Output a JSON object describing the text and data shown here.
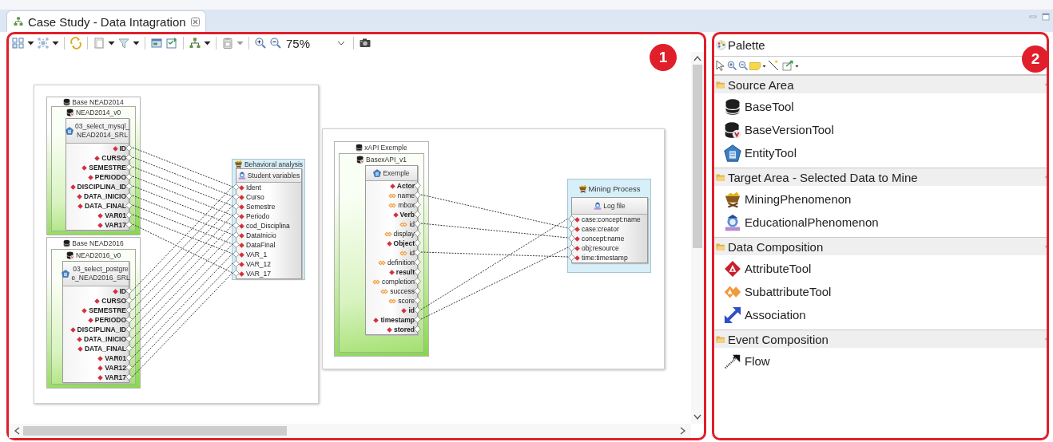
{
  "tab": {
    "title": "Case Study - Data Intagration",
    "selected": true
  },
  "editor": {
    "zoom": "75%",
    "callout": "1",
    "frames": [
      {
        "nodes": [
          {
            "kind": "source",
            "title": "Base NEAD2014",
            "version": "NEAD2014_v0",
            "entity": "03_select_mysql_\nNEAD2014_SRL",
            "attributes": [
              {
                "label": "ID",
                "kind": "attribute"
              },
              {
                "label": "CURSO",
                "kind": "attribute"
              },
              {
                "label": "SEMESTRE",
                "kind": "attribute"
              },
              {
                "label": "PERIODO",
                "kind": "attribute"
              },
              {
                "label": "DISCIPLINA_ID",
                "kind": "attribute"
              },
              {
                "label": "DATA_INICIO",
                "kind": "attribute"
              },
              {
                "label": "DATA_FINAL",
                "kind": "attribute"
              },
              {
                "label": "VAR01",
                "kind": "attribute"
              },
              {
                "label": "VAR17",
                "kind": "attribute"
              }
            ]
          },
          {
            "kind": "source",
            "title": "Base NEAD2016",
            "version": "NEAD2016_v0",
            "entity": "03_select_postgre\ne_NEAD2016_SRL",
            "attributes": [
              {
                "label": "ID",
                "kind": "attribute"
              },
              {
                "label": "CURSO",
                "kind": "attribute"
              },
              {
                "label": "SEMESTRE",
                "kind": "attribute"
              },
              {
                "label": "PERIODO",
                "kind": "attribute"
              },
              {
                "label": "DISCIPLINA_ID",
                "kind": "attribute"
              },
              {
                "label": "DATA_INICIO",
                "kind": "attribute"
              },
              {
                "label": "DATA_FINAL",
                "kind": "attribute"
              },
              {
                "label": "VAR01",
                "kind": "attribute"
              },
              {
                "label": "VAR12",
                "kind": "attribute"
              },
              {
                "label": "VAR17",
                "kind": "attribute"
              }
            ]
          },
          {
            "kind": "target",
            "title": "Behavioral analysis",
            "entity": "Student variables",
            "attributes": [
              {
                "label": "Ident",
                "kind": "attribute"
              },
              {
                "label": "Curso",
                "kind": "attribute"
              },
              {
                "label": "Semestre",
                "kind": "attribute"
              },
              {
                "label": "Periodo",
                "kind": "attribute"
              },
              {
                "label": "cod_Disciplina",
                "kind": "attribute"
              },
              {
                "label": "DataInicio",
                "kind": "attribute"
              },
              {
                "label": "DataFinal",
                "kind": "attribute"
              },
              {
                "label": "VAR_1",
                "kind": "attribute"
              },
              {
                "label": "VAR_12",
                "kind": "attribute"
              },
              {
                "label": "VAR_17",
                "kind": "attribute"
              }
            ]
          }
        ]
      },
      {
        "nodes": [
          {
            "kind": "source",
            "title": "xAPI Exemple",
            "version": "BasexAPI_v1",
            "entity": "Exemple",
            "attributes": [
              {
                "label": "Actor",
                "kind": "attribute"
              },
              {
                "label": "name",
                "kind": "subattribute"
              },
              {
                "label": "mbox",
                "kind": "subattribute"
              },
              {
                "label": "Verb",
                "kind": "attribute"
              },
              {
                "label": "id",
                "kind": "subattribute"
              },
              {
                "label": "display",
                "kind": "subattribute"
              },
              {
                "label": "Object",
                "kind": "attribute"
              },
              {
                "label": "id",
                "kind": "subattribute"
              },
              {
                "label": "definition",
                "kind": "subattribute"
              },
              {
                "label": "result",
                "kind": "attribute"
              },
              {
                "label": "completion",
                "kind": "subattribute"
              },
              {
                "label": "success",
                "kind": "subattribute"
              },
              {
                "label": "score",
                "kind": "subattribute"
              },
              {
                "label": "id",
                "kind": "attribute"
              },
              {
                "label": "timestamp",
                "kind": "attribute"
              },
              {
                "label": "stored",
                "kind": "attribute"
              }
            ]
          },
          {
            "kind": "target",
            "title": "Mining Process",
            "entity": "Log file",
            "attributes": [
              {
                "label": "case:concept:name",
                "kind": "attribute"
              },
              {
                "label": "case:creator",
                "kind": "attribute"
              },
              {
                "label": "concept:name",
                "kind": "attribute"
              },
              {
                "label": "obj:resource",
                "kind": "attribute"
              },
              {
                "label": "time:timestamp",
                "kind": "attribute"
              }
            ]
          }
        ]
      }
    ]
  },
  "palette": {
    "title": "Palette",
    "callout": "2",
    "drawers": [
      {
        "label": "Source Area",
        "expanded": true,
        "items": [
          {
            "label": "BaseTool",
            "kind": "base"
          },
          {
            "label": "BaseVersionTool",
            "kind": "base-version"
          },
          {
            "label": "EntityTool",
            "kind": "entity"
          }
        ]
      },
      {
        "label": "Target Area - Selected Data to Mine",
        "expanded": true,
        "items": [
          {
            "label": "MiningPhenomenon",
            "kind": "mining"
          },
          {
            "label": "EducationalPhenomenon",
            "kind": "educational"
          }
        ]
      },
      {
        "label": "Data Composition",
        "expanded": true,
        "items": [
          {
            "label": "AttributeTool",
            "kind": "attribute"
          },
          {
            "label": "SubattributeTool",
            "kind": "subattribute"
          },
          {
            "label": "Association",
            "kind": "association"
          }
        ]
      },
      {
        "label": "Event Composition",
        "expanded": true,
        "items": [
          {
            "label": "Flow",
            "kind": "flow"
          }
        ]
      }
    ]
  }
}
